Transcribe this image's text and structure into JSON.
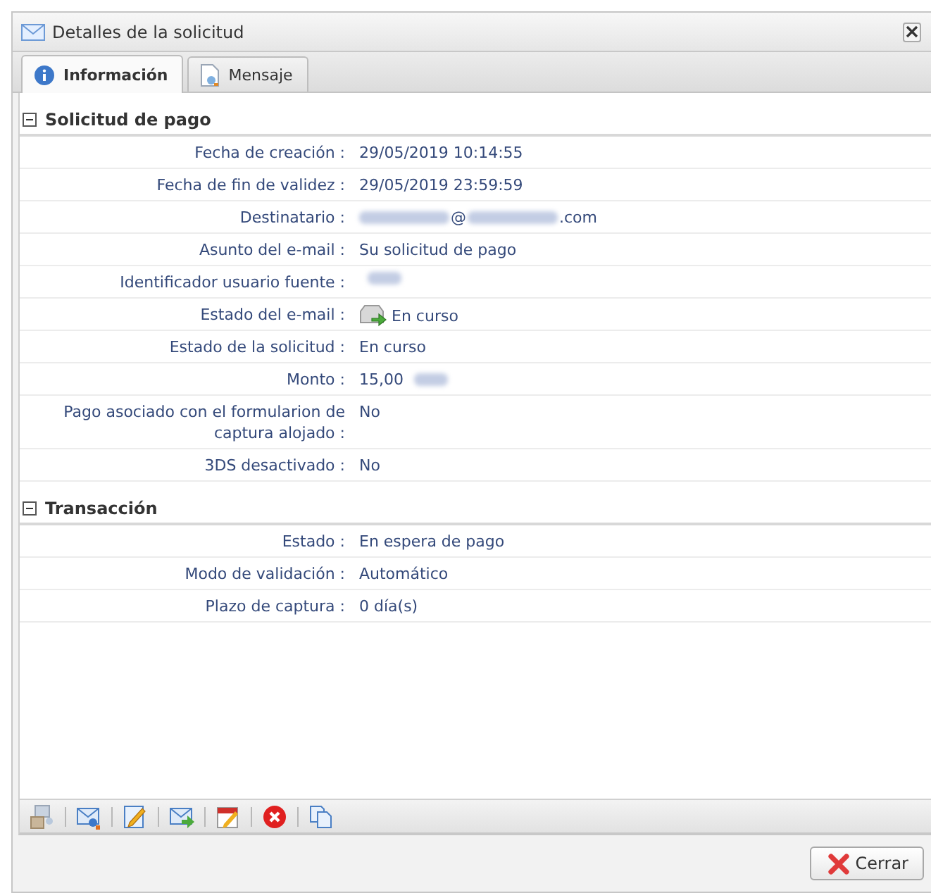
{
  "window": {
    "title": "Detalles de la solicitud"
  },
  "tabs": [
    {
      "label": "Información",
      "selected": true
    },
    {
      "label": "Mensaje",
      "selected": false
    }
  ],
  "sections": [
    {
      "title": "Solicitud de pago",
      "expanded": true,
      "rows": [
        {
          "label": "Fecha de creación :",
          "value": [
            {
              "kind": "text",
              "text": "29/05/2019 10:14:55"
            }
          ]
        },
        {
          "label": "Fecha de fin de validez :",
          "value": [
            {
              "kind": "text",
              "text": "29/05/2019 23:59:59"
            }
          ]
        },
        {
          "label": "Destinatario :",
          "value": [
            {
              "kind": "blur"
            },
            {
              "kind": "text",
              "text": "@"
            },
            {
              "kind": "blur"
            },
            {
              "kind": "text",
              "text": ".com"
            }
          ]
        },
        {
          "label": "Asunto del e-mail :",
          "value": [
            {
              "kind": "text",
              "text": "Su solicitud de pago"
            }
          ]
        },
        {
          "label": "Identificador usuario fuente :",
          "value": [
            {
              "kind": "blur"
            }
          ]
        },
        {
          "label": "Estado del e-mail :",
          "value": [
            {
              "kind": "icon"
            },
            {
              "kind": "text",
              "text": "En curso"
            }
          ]
        },
        {
          "label": "Estado de la solicitud :",
          "value": [
            {
              "kind": "text",
              "text": "En curso"
            }
          ]
        },
        {
          "label": "Monto :",
          "value": [
            {
              "kind": "text",
              "text": "15,00"
            },
            {
              "kind": "blur"
            }
          ]
        },
        {
          "label": "Pago asociado con el formularion de captura alojado :",
          "value": [
            {
              "kind": "text",
              "text": "No"
            }
          ]
        },
        {
          "label": "3DS desactivado :",
          "value": [
            {
              "kind": "text",
              "text": "No"
            }
          ]
        }
      ]
    },
    {
      "title": "Transacción",
      "expanded": true,
      "rows": [
        {
          "label": "Estado :",
          "value": [
            {
              "kind": "text",
              "text": "En espera de pago"
            }
          ]
        },
        {
          "label": "Modo de validación :",
          "value": [
            {
              "kind": "text",
              "text": "Automático"
            }
          ]
        },
        {
          "label": "Plazo de captura :",
          "value": [
            {
              "kind": "text",
              "text": "0 día(s)"
            }
          ]
        }
      ]
    }
  ],
  "buttons": [
    {
      "label": "Cerrar"
    }
  ]
}
